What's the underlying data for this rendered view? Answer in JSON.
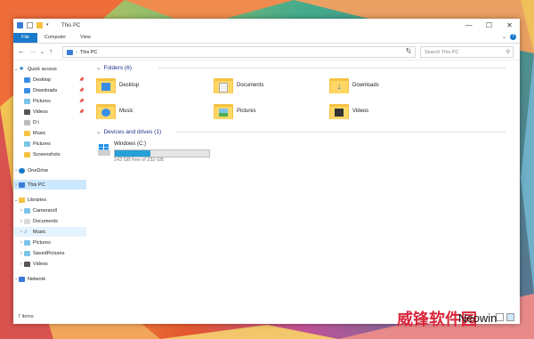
{
  "window": {
    "title": "This PC"
  },
  "ribbon": {
    "tabs": [
      "File",
      "Computer",
      "View"
    ]
  },
  "address": {
    "path_root_glyph": "›",
    "location": "This PC",
    "search_placeholder": "Search This PC"
  },
  "nav": {
    "quick_access": "Quick access",
    "qa_items": [
      "Desktop",
      "Downloads",
      "Pictures",
      "Videos",
      "D:\\",
      "Music",
      "Pictures",
      "Screenshots"
    ],
    "onedrive": "OneDrive",
    "this_pc": "This PC",
    "libraries": "Libraries",
    "lib_items": [
      "Cameraroll",
      "Documents",
      "Music",
      "Pictures",
      "SavedPictures",
      "Videos"
    ],
    "network": "Network"
  },
  "content": {
    "folders_header": "Folders (6)",
    "folders": [
      "Desktop",
      "Documents",
      "Downloads",
      "Music",
      "Pictures",
      "Videos"
    ],
    "drives_header": "Devices and drives (1)",
    "drive": {
      "name": "Windows (C:)",
      "free_text": "143 GB free of 232 GB",
      "used_fraction": 0.38
    }
  },
  "status": {
    "items": "7 items"
  },
  "watermark": {
    "cn": "威锋软件园",
    "brand": "Neowin"
  },
  "colors": {
    "accent": "#1979ca",
    "folder": "#ffd766",
    "drive_fill": "#26a0da",
    "group_header": "#1e3287"
  }
}
